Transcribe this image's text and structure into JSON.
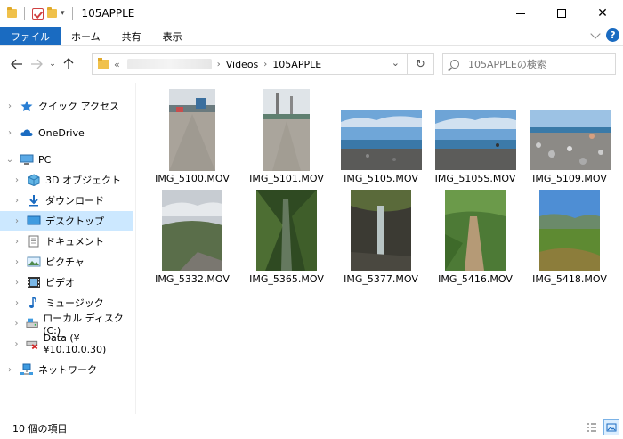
{
  "window": {
    "title": "105APPLE"
  },
  "ribbon": {
    "tabs": [
      "ファイル",
      "ホーム",
      "共有",
      "表示"
    ],
    "help": "?"
  },
  "address": {
    "prefix": "«",
    "crumbs": [
      "Videos",
      "105APPLE"
    ]
  },
  "search": {
    "placeholder": "105APPLEの検索"
  },
  "nav": {
    "quick_access": "クイック アクセス",
    "onedrive": "OneDrive",
    "pc": "PC",
    "objects3d": "3D オブジェクト",
    "downloads": "ダウンロード",
    "desktop": "デスクトップ",
    "documents": "ドキュメント",
    "pictures": "ピクチャ",
    "videos": "ビデオ",
    "music": "ミュージック",
    "local_disk": "ローカル ディスク (C:)",
    "data_drive": "Data (¥¥10.10.0.30)",
    "network": "ネットワーク"
  },
  "files": [
    {
      "name": "IMG_5100.MOV"
    },
    {
      "name": "IMG_5101.MOV"
    },
    {
      "name": "IMG_5105.MOV"
    },
    {
      "name": "IMG_5105S.MOV"
    },
    {
      "name": "IMG_5109.MOV"
    },
    {
      "name": "IMG_5332.MOV"
    },
    {
      "name": "IMG_5365.MOV"
    },
    {
      "name": "IMG_5377.MOV"
    },
    {
      "name": "IMG_5416.MOV"
    },
    {
      "name": "IMG_5418.MOV"
    }
  ],
  "status": {
    "item_count": "10 個の項目"
  },
  "colors": {
    "accent": "#1a6bc1",
    "selection": "#cce8ff"
  }
}
